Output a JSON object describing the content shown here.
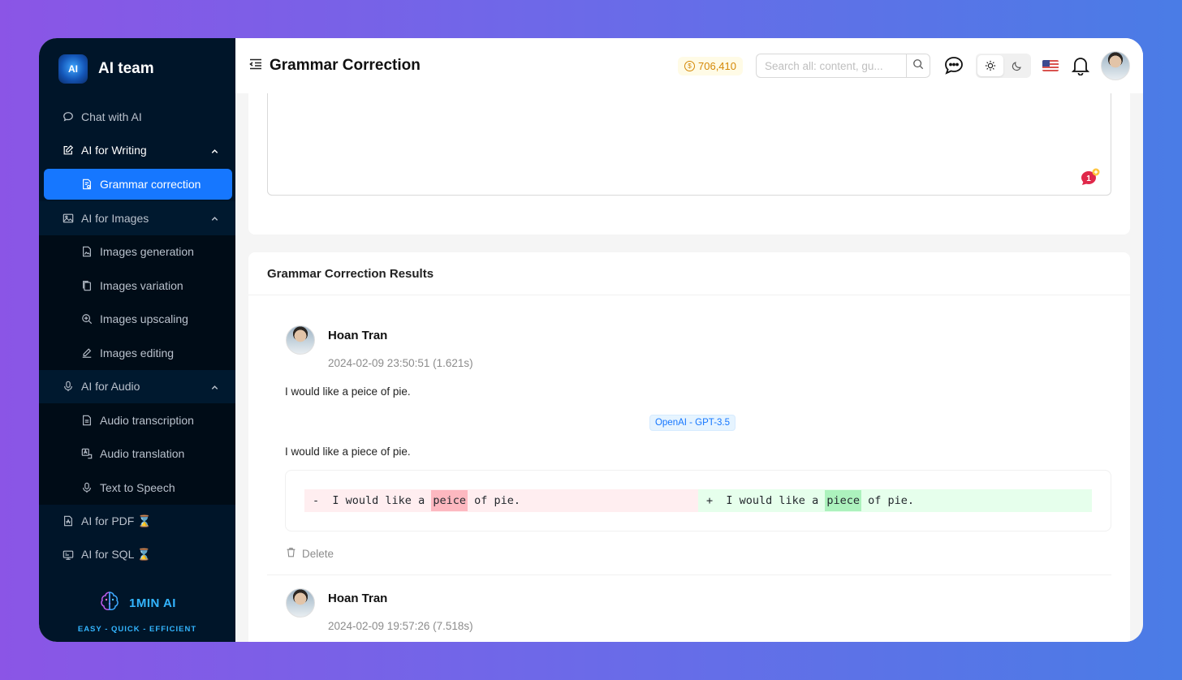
{
  "brand": {
    "name": "AI team",
    "logo_text": "AI"
  },
  "sidebar": {
    "items": [
      {
        "label": "Chat with AI",
        "icon": "chat-icon"
      },
      {
        "label": "AI for Writing",
        "icon": "edit-icon"
      },
      {
        "label": "Grammar correction",
        "icon": "doc-check-icon"
      },
      {
        "label": "AI for Images",
        "icon": "image-icon"
      },
      {
        "label": "Images generation",
        "icon": "file-image-icon"
      },
      {
        "label": "Images variation",
        "icon": "copy-icon"
      },
      {
        "label": "Images upscaling",
        "icon": "zoom-in-icon"
      },
      {
        "label": "Images editing",
        "icon": "pencil-icon"
      },
      {
        "label": "AI for Audio",
        "icon": "mic-icon"
      },
      {
        "label": "Audio transcription",
        "icon": "file-text-icon"
      },
      {
        "label": "Audio translation",
        "icon": "translate-icon"
      },
      {
        "label": "Text to Speech",
        "icon": "mic-icon"
      },
      {
        "label": "AI for PDF ⌛",
        "icon": "pdf-icon"
      },
      {
        "label": "AI for SQL ⌛",
        "icon": "database-icon"
      }
    ]
  },
  "footer_brand": {
    "name": "1MIN AI",
    "tagline": "EASY - QUICK - EFFICIENT"
  },
  "header": {
    "title": "Grammar Correction",
    "credits": "706,410",
    "search_placeholder": "Search all: content, gu..."
  },
  "results": {
    "title": "Grammar Correction Results",
    "entries": [
      {
        "user": "Hoan Tran",
        "time": "2024-02-09 23:50:51 (1.621s)",
        "input": "I would like a peice of pie.",
        "model": "OpenAI - GPT-3.5",
        "output": "I would like a piece of pie.",
        "diff": {
          "old_sign": "-",
          "old_pre": "I would like a ",
          "old_word": "peice",
          "old_post": " of pie.",
          "new_sign": "+",
          "new_pre": "I would like a ",
          "new_word": "piece",
          "new_post": " of pie."
        },
        "delete_label": "Delete"
      },
      {
        "user": "Hoan Tran",
        "time": "2024-02-09 19:57:26 (7.518s)"
      }
    ]
  },
  "notification_badge": "1",
  "colors": {
    "accent": "#1677ff",
    "sidebar_bg": "#001529",
    "credits": "#d48806"
  }
}
